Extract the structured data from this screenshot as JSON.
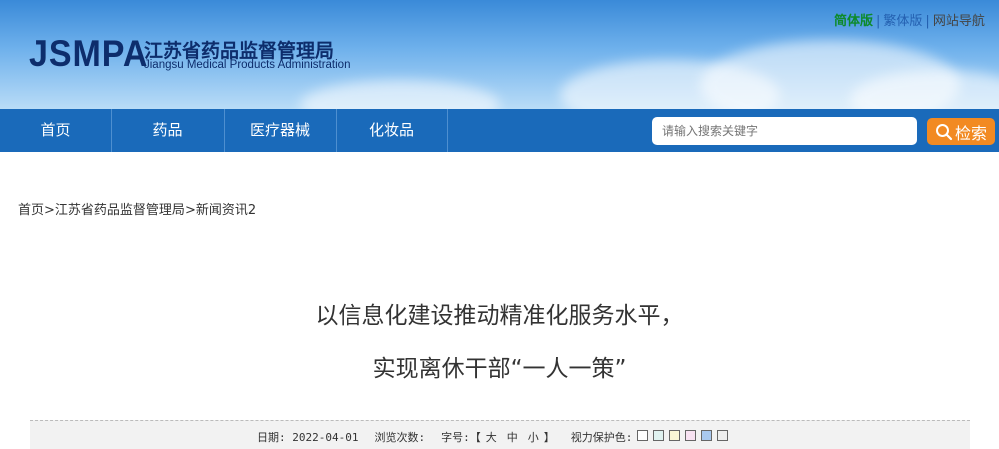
{
  "header": {
    "logo_text": "JSMPA",
    "title_cn": "江苏省药品监督管理局",
    "title_en": "Jiangsu Medical Products Administration",
    "links": {
      "simplified": "简体版",
      "traditional": "繁体版",
      "sitemap": "网站导航"
    },
    "separator": "|"
  },
  "nav": {
    "items": [
      {
        "label": "首页"
      },
      {
        "label": "药品"
      },
      {
        "label": "医疗器械"
      },
      {
        "label": "化妆品"
      }
    ]
  },
  "search": {
    "placeholder": "请输入搜索关键字",
    "button_label": "检索",
    "icon": "search-icon"
  },
  "breadcrumb": {
    "items": [
      "首页",
      "江苏省药品监督管理局",
      "新闻资讯2"
    ],
    "separator": ">"
  },
  "article": {
    "title_line1": "以信息化建设推动精准化服务水平，",
    "title_line2": "实现离休干部“一人一策”"
  },
  "meta": {
    "date_label": "日期:",
    "date_value": "2022-04-01",
    "views_label": "浏览次数:",
    "font_label": "字号:",
    "bracket_open": "【",
    "bracket_close": "】",
    "font_large": "大",
    "font_medium": "中",
    "font_small": "小",
    "eye_label": "视力保护色:",
    "swatches": [
      "#ffffff",
      "#e0f2f0",
      "#faf7d6",
      "#f8e2f2",
      "#a9c8ee",
      "#eeeeee"
    ]
  },
  "colors": {
    "nav_bg": "#1a6aba",
    "search_button": "#f28a22",
    "brand": "#0d2d6c"
  }
}
